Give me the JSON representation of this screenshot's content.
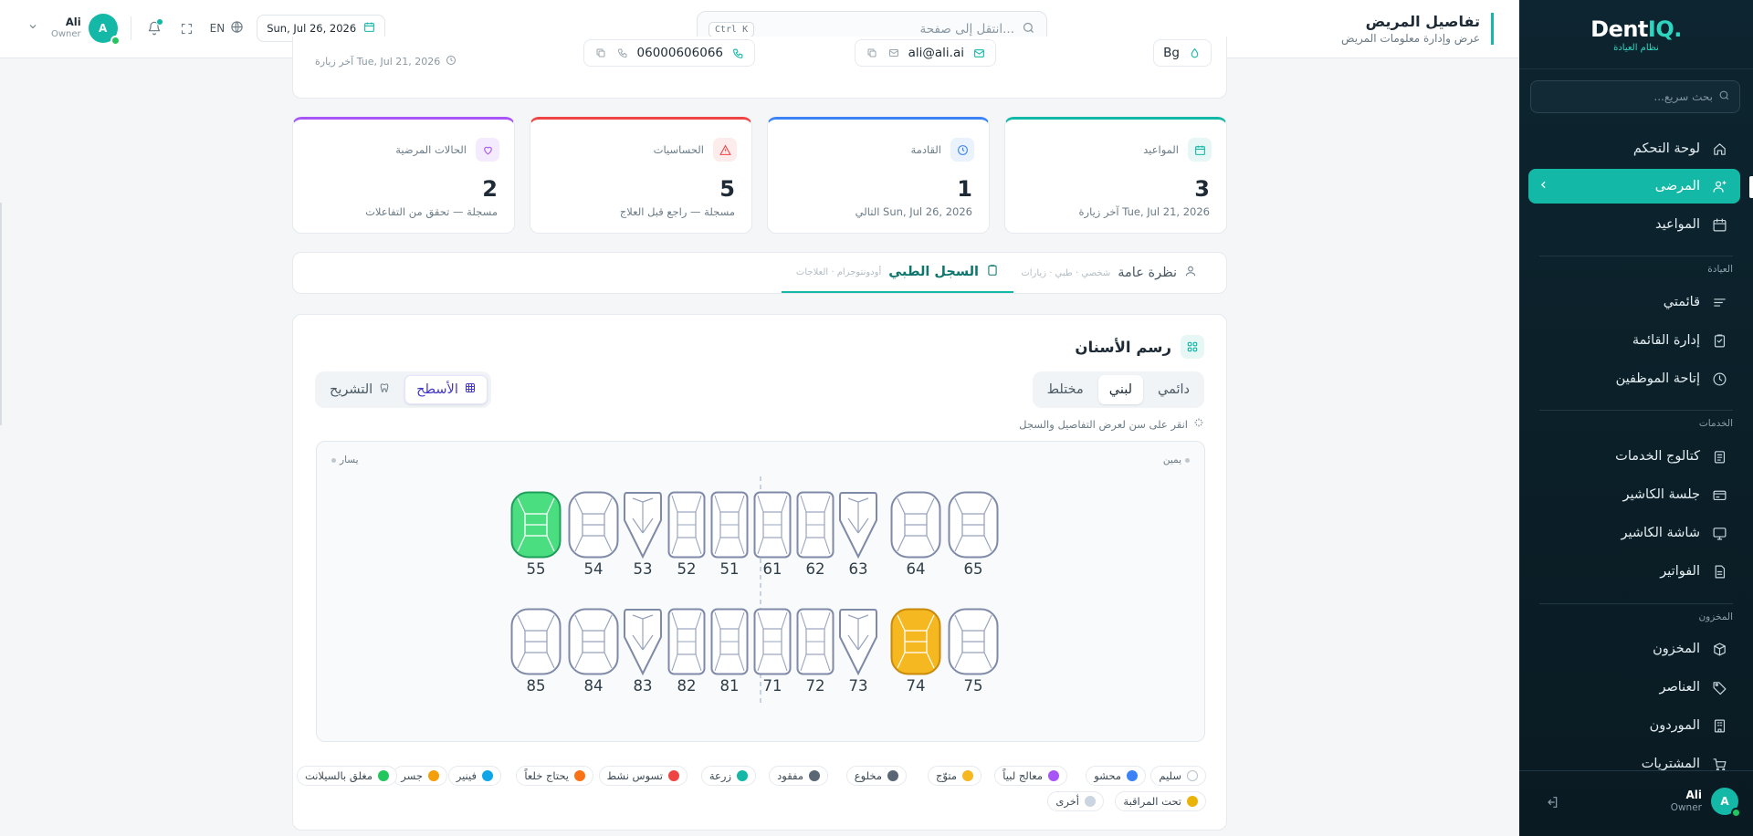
{
  "app": {
    "logo_prefix": "Dent",
    "logo_suffix": "IQ.",
    "logo_subtitle": "نظام العيادة"
  },
  "header": {
    "title": "تفاصيل المريض",
    "subtitle": "عرض وإدارة معلومات المريض",
    "search_placeholder": "انتقل إلى صفحة...",
    "search_shortcut": "Ctrl K",
    "date": "Sun, Jul 26, 2026",
    "language": "EN",
    "user_name": "Ali",
    "user_role": "Owner",
    "avatar_letter": "A"
  },
  "sidebar": {
    "search_placeholder": "بحث سريع...",
    "items_main": [
      {
        "label": "لوحة التحكم",
        "icon": "home-icon"
      },
      {
        "label": "المرضى",
        "icon": "patients-icon"
      },
      {
        "label": "المواعيد",
        "icon": "calendar-icon"
      }
    ],
    "group_clinic": "العيادة",
    "items_clinic": [
      {
        "label": "قائمتي",
        "icon": "list-icon"
      },
      {
        "label": "إدارة القائمة",
        "icon": "clipboard-icon"
      },
      {
        "label": "إتاحة الموظفين",
        "icon": "clock-icon"
      }
    ],
    "group_services": "الخدمات",
    "items_services": [
      {
        "label": "كتالوج الخدمات",
        "icon": "catalog-icon"
      },
      {
        "label": "جلسة الكاشير",
        "icon": "cashier-icon"
      },
      {
        "label": "شاشة الكاشير",
        "icon": "screen-icon"
      },
      {
        "label": "الفواتير",
        "icon": "invoice-icon"
      }
    ],
    "group_inventory": "المخزون",
    "items_inventory": [
      {
        "label": "المخزون",
        "icon": "box-icon"
      },
      {
        "label": "العناصر",
        "icon": "tag-icon"
      },
      {
        "label": "الموردون",
        "icon": "building-icon"
      },
      {
        "label": "المشتريات",
        "icon": "cart-icon"
      }
    ],
    "user_name": "Ali",
    "user_role": "Owner",
    "avatar_letter": "A"
  },
  "patient_info": {
    "phone": "06000606066",
    "email": "ali@ali.ai",
    "blood": "Bg",
    "last_visit": "آخر زيارة Tue, Jul 21, 2026"
  },
  "stats": [
    {
      "label": "المواعيد",
      "value": "3",
      "sub": "آخر زيارة Tue, Jul 21, 2026",
      "color": "#14b8a6"
    },
    {
      "label": "القادمة",
      "value": "1",
      "sub": "التالي Sun, Jul 26, 2026",
      "color": "#3b82f6"
    },
    {
      "label": "الحساسيات",
      "value": "5",
      "sub": "مسجلة — راجع قبل العلاج",
      "color": "#ef4444"
    },
    {
      "label": "الحالات المرضية",
      "value": "2",
      "sub": "مسجلة — تحقق من التفاعلات",
      "color": "#a855f7"
    }
  ],
  "tabs": [
    {
      "label": "نظرة عامة",
      "hint": "شخصي · طبي · زيارات"
    },
    {
      "label": "السجل الطبي",
      "hint": "أودونتوجرام · العلاجات"
    }
  ],
  "dental_chart": {
    "title": "رسم الأسنان",
    "dentition_options": [
      "دائمي",
      "لبني",
      "مختلط"
    ],
    "dentition_selected": "لبني",
    "view_options": [
      "الأسطح",
      "التشريح"
    ],
    "view_selected": "الأسطح",
    "hint": "انقر على سن لعرض التفاصيل والسجل",
    "right_label": "يمين",
    "left_label": "يسار",
    "upper_teeth": [
      {
        "n": "55",
        "type": "molar",
        "status": "veneer"
      },
      {
        "n": "54",
        "type": "molar",
        "status": "healthy"
      },
      {
        "n": "53",
        "type": "canine",
        "status": "healthy"
      },
      {
        "n": "52",
        "type": "incisor",
        "status": "healthy"
      },
      {
        "n": "51",
        "type": "incisor",
        "status": "healthy"
      },
      {
        "n": "61",
        "type": "incisor",
        "status": "healthy"
      },
      {
        "n": "62",
        "type": "incisor",
        "status": "healthy"
      },
      {
        "n": "63",
        "type": "canine",
        "status": "healthy"
      },
      {
        "n": "64",
        "type": "molar",
        "status": "healthy"
      },
      {
        "n": "65",
        "type": "molar",
        "status": "healthy"
      }
    ],
    "lower_teeth": [
      {
        "n": "85",
        "type": "molar",
        "status": "healthy"
      },
      {
        "n": "84",
        "type": "molar",
        "status": "healthy"
      },
      {
        "n": "83",
        "type": "canine",
        "status": "healthy"
      },
      {
        "n": "82",
        "type": "incisor",
        "status": "healthy"
      },
      {
        "n": "81",
        "type": "incisor",
        "status": "healthy"
      },
      {
        "n": "71",
        "type": "incisor",
        "status": "healthy"
      },
      {
        "n": "72",
        "type": "incisor",
        "status": "healthy"
      },
      {
        "n": "73",
        "type": "canine",
        "status": "healthy"
      },
      {
        "n": "74",
        "type": "molar",
        "status": "crown"
      },
      {
        "n": "75",
        "type": "molar",
        "status": "healthy"
      }
    ]
  },
  "legend": [
    {
      "label": "سليم",
      "color": "#ffffff"
    },
    {
      "label": "محشو",
      "color": "#3b82f6"
    },
    {
      "label": "معالج لبياً",
      "color": "#a855f7"
    },
    {
      "label": "متوّج",
      "color": "#f5b820"
    },
    {
      "label": "مخلوع",
      "color": "#5b6675"
    },
    {
      "label": "مفقود",
      "color": "#5b6675"
    },
    {
      "label": "زرعة",
      "color": "#14b8a6"
    },
    {
      "label": "تسوس نشط",
      "color": "#ef4444"
    },
    {
      "label": "يحتاج خلعاً",
      "color": "#f97316"
    },
    {
      "label": "فينير",
      "color": "#0ea5e9"
    },
    {
      "label": "جسر",
      "color": "#f59e0b"
    },
    {
      "label": "مغلق بالسيلانت",
      "color": "#22c55e"
    },
    {
      "label": "تحت المراقبة",
      "color": "#eab308"
    },
    {
      "label": "أخرى",
      "color": "#cbd5e1"
    }
  ],
  "colors": {
    "accent": "#14b8a6",
    "veneer_fill": "#4ade80",
    "crown_fill": "#f5b820"
  }
}
